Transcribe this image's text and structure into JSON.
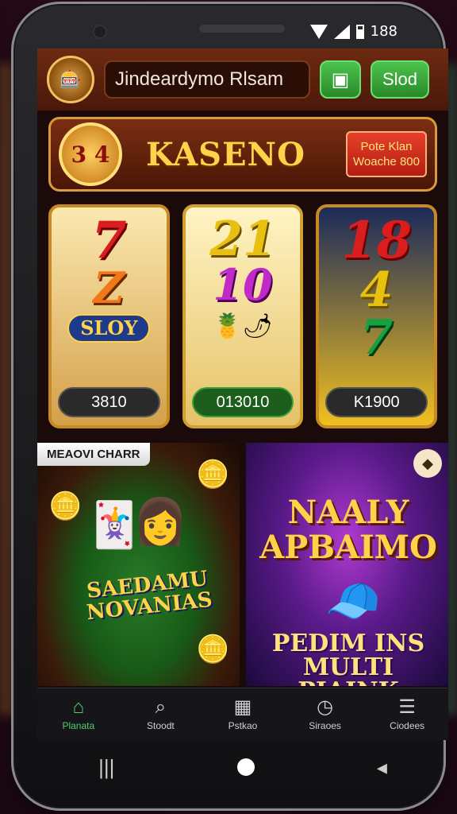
{
  "status_bar": {
    "time": "188"
  },
  "header": {
    "badge_icon": "casino-badge-icon",
    "search_text": "Jindeardymo Rlsam",
    "chat_icon": "chat-icon",
    "slot_button": "Slod"
  },
  "banner": {
    "chip_text": "3 4",
    "title": "KASENO",
    "promo_line1": "Pote Klan",
    "promo_line2": "Woache 800"
  },
  "reels": [
    {
      "symbol_top": "7",
      "symbol_mid": "Z",
      "symbol_label": "SLOY",
      "value": "3810"
    },
    {
      "symbol_top": "21",
      "symbol_mid": "10",
      "fruit": "🍍🌶",
      "value": "013010"
    },
    {
      "symbol_top": "18",
      "symbol_mid": "4",
      "symbol_bot": "7",
      "value": "K1900"
    }
  ],
  "cards": [
    {
      "label": "MEAOVI CHARR",
      "title": "SAEDAMU NOVANIAS",
      "icon": "poker-table-icon"
    },
    {
      "title": "NAALY APBAIMO",
      "subtitle": "PEDIM INS MULTI PIAINK",
      "corner_icon": "badge-icon"
    }
  ],
  "bottom_nav": [
    {
      "label": "Planata",
      "icon": "home-icon",
      "active": true
    },
    {
      "label": "Stoodt",
      "icon": "search-icon",
      "active": false
    },
    {
      "label": "Pstkao",
      "icon": "slot-machine-icon",
      "active": false
    },
    {
      "label": "Siraoes",
      "icon": "clock-icon",
      "active": false
    },
    {
      "label": "Ciodees",
      "icon": "menu-icon",
      "active": false
    }
  ],
  "colors": {
    "accent_gold": "#ffd24a",
    "accent_green": "#4cd06a",
    "header_brown": "#6e2a12"
  }
}
